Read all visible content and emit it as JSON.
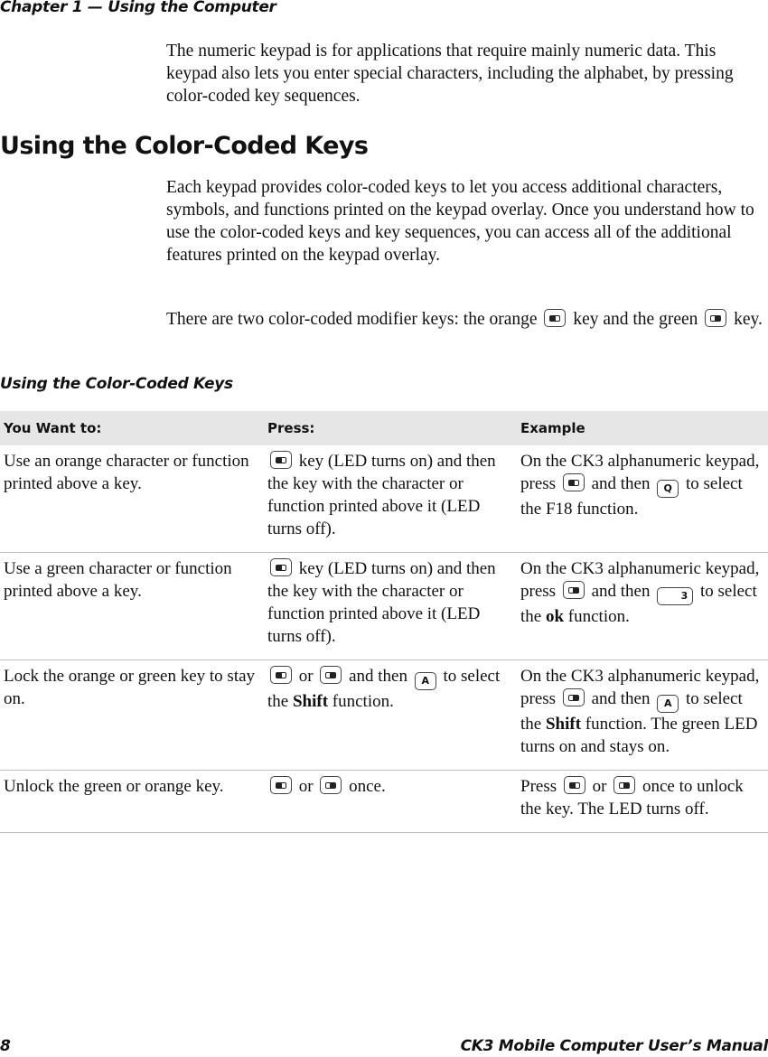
{
  "header": {
    "chapter": "Chapter 1 — Using the Computer"
  },
  "intro": "The numeric keypad is for applications that require mainly numeric data. This keypad also lets you enter special characters, including the alphabet, by pressing color-coded key sequences.",
  "section": {
    "title": "Using the Color-Coded Keys",
    "para1": "Each keypad provides color-coded keys to let you access additional characters, symbols, and functions printed on the keypad overlay. Once you understand how to use the color-coded keys and key sequences, you can access all of the additional features printed on the keypad overlay.",
    "para2_a": "There are two color-coded modifier keys: the orange",
    "para2_b": "key and the green",
    "para2_c": "key."
  },
  "table": {
    "caption": "Using the Color-Coded Keys",
    "headers": [
      "You Want to:",
      "Press:",
      "Example"
    ],
    "rows": [
      {
        "want": "Use an orange character or function printed above a key.",
        "press": "key (LED turns on) and then the key with the character or function printed above it (LED turns off).",
        "ex_a": "On the CK3 alphanumeric keypad, press",
        "ex_b": "and then",
        "ex_c": "to select the F18 function.",
        "key_label": "Q"
      },
      {
        "want": "Use a green character or function printed above a key.",
        "press": "key (LED turns on) and then the key with the character or function printed above it (LED turns off).",
        "ex_a": "On the CK3 alphanumeric keypad, press",
        "ex_b": "and then",
        "ex_c": "to select the",
        "ex_bold": "ok",
        "ex_d": "function.",
        "key_label": "3"
      },
      {
        "want": "Lock the orange or green key to stay on.",
        "press_or": "or",
        "press_then": "and then",
        "press_to": "to select the",
        "press_bold": "Shift",
        "press_end": "function.",
        "ex_a": "On the CK3 alphanumeric keypad, press",
        "ex_b": "and then",
        "ex_c": "to select the",
        "ex_bold": "Shift",
        "ex_d": "function. The green LED turns on and stays on.",
        "key_label": "A"
      },
      {
        "want": "Unlock the green or orange key.",
        "press_or": "or",
        "press_end": "once.",
        "ex_a": "Press",
        "ex_or": "or",
        "ex_b": "once to unlock the key. The LED turns off."
      }
    ]
  },
  "footer": {
    "page": "8",
    "title": "CK3 Mobile Computer User’s Manual"
  }
}
